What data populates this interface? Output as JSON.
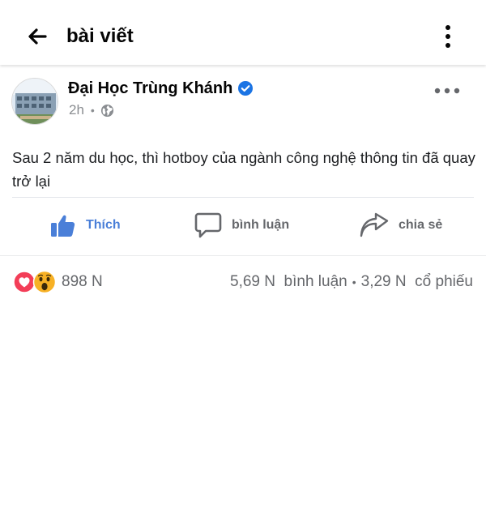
{
  "header": {
    "title": "bài viết",
    "back_icon": "arrow-left-icon",
    "menu_icon": "kebab-menu-icon"
  },
  "post": {
    "author": "Đại Học Trùng Khánh",
    "verified": true,
    "time": "2h",
    "visibility_icon": "globe-icon",
    "more_icon": "more-dots-icon",
    "text": "Sau 2 năm du học, thì hotboy của ngành công nghệ thông tin đã quay trở lại"
  },
  "actions": {
    "like_label": "Thích",
    "comment_label": "bình luận",
    "share_label": "chia sẻ"
  },
  "stats": {
    "reaction_count": "898 N",
    "reaction_icons": [
      "love-reaction-icon",
      "wow-reaction-icon"
    ],
    "comments": "5,69 N  bình luận",
    "separator": "•",
    "shares": "3,29 N  cổ phiếu"
  },
  "colors": {
    "like_blue": "#4a7fd8",
    "verified_blue": "#1b74e4",
    "love_red": "#f33e58",
    "wow_yellow": "#f7b125",
    "muted_text": "#65676b"
  }
}
